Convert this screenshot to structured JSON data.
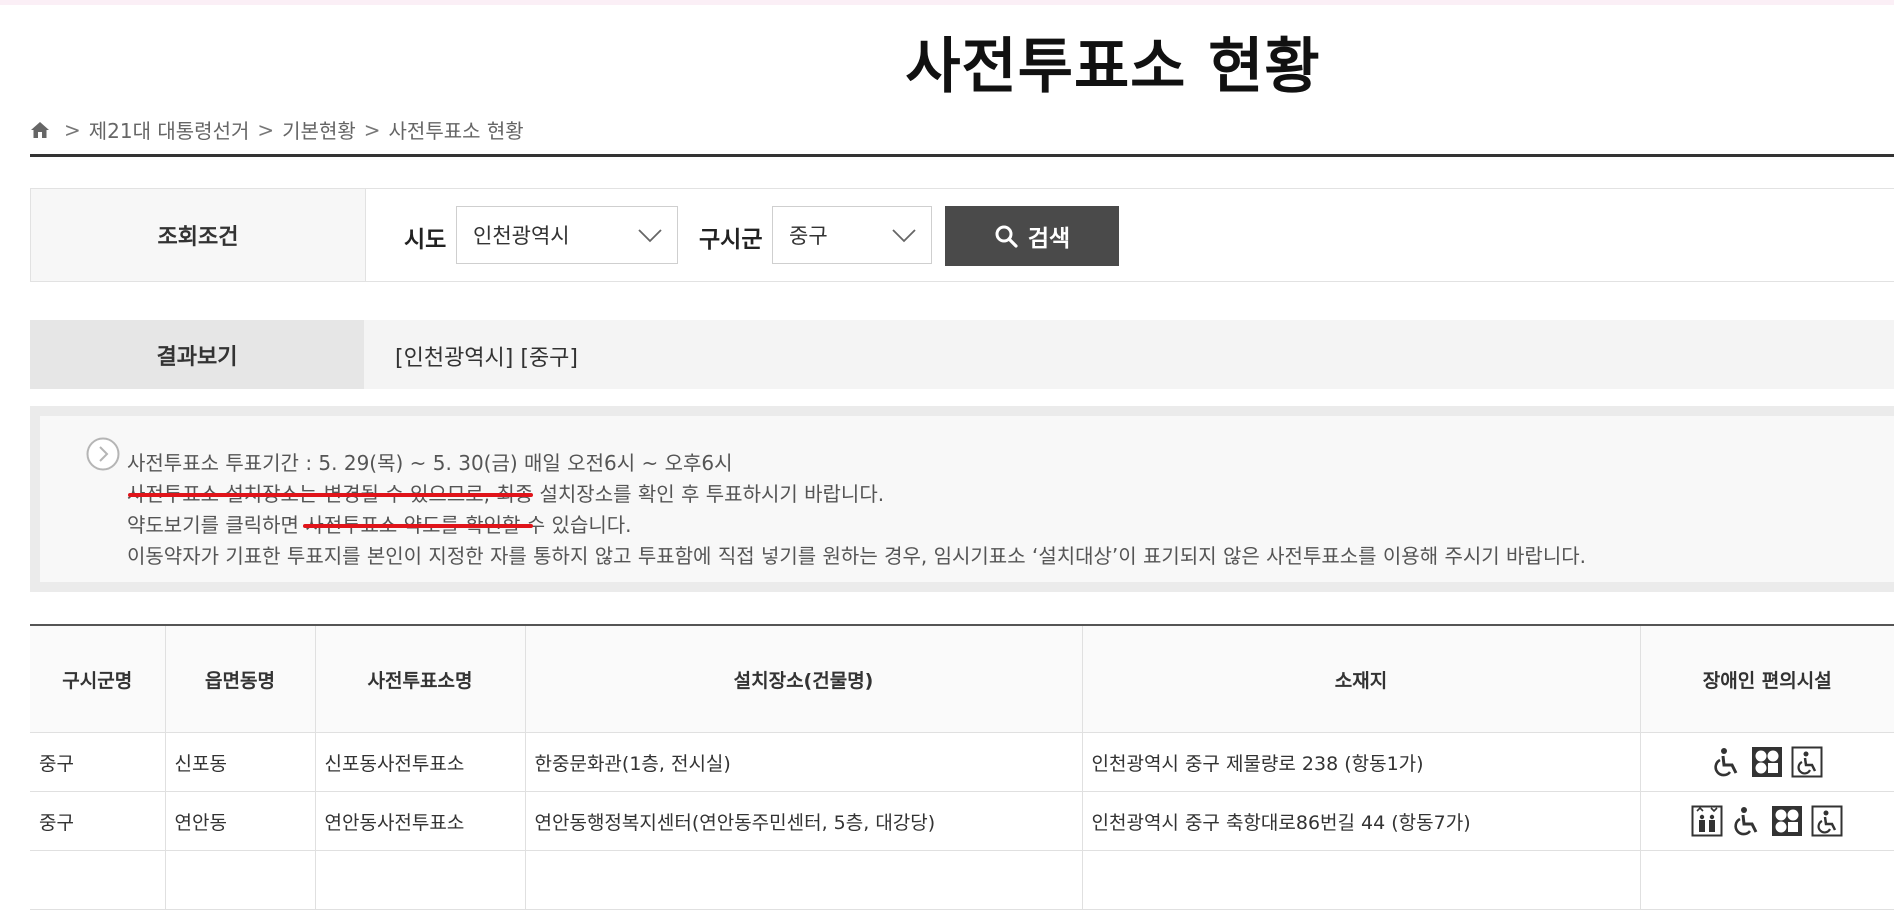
{
  "page_title": "사전투표소 현황",
  "breadcrumb": {
    "items": [
      "제21대 대통령선거",
      "기본현황",
      "사전투표소 현황"
    ],
    "separator": ">"
  },
  "search": {
    "label": "조회조건",
    "sido_label": "시도",
    "sido_value": "인천광역시",
    "sigungu_label": "구시군",
    "sigungu_value": "중구",
    "button_label": "검색"
  },
  "result": {
    "label": "결과보기",
    "value": "[인천광역시] [중구]"
  },
  "notice": {
    "lines": [
      "사전투표소 투표기간 : 5. 29(목) ~ 5. 30(금) 매일 오전6시 ~ 오후6시",
      "사전투표소 설치장소는 변경될 수 있으므로, 최종 설치장소를 확인 후 투표하시기 바랍니다.",
      "약도보기를 클릭하면 사전투표소 약도를 확인할 수 있습니다.",
      "이동약자가 기표한 투표지를 본인이 지정한 자를 통하지 않고 투표함에 직접 넣기를 원하는 경우, 임시기표소 ‘설치대상’이 표기되지 않은 사전투표소를 이용해 주시기 바랍니다."
    ],
    "underline_color": "#e0141a"
  },
  "table": {
    "headers": [
      "구시군명",
      "읍면동명",
      "사전투표소명",
      "설치장소(건물명)",
      "소재지",
      "장애인 편의시설"
    ],
    "rows": [
      {
        "cells": [
          "중구",
          "신포동",
          "신포동사전투표소",
          "한중문화관(1층, 전시실)",
          "인천광역시 중구 제물량로 238 (항동1가)"
        ],
        "facilities": [
          "wheelchair-icon",
          "braille-block-icon",
          "wheelchair-ramp-icon"
        ]
      },
      {
        "cells": [
          "중구",
          "연안동",
          "연안동사전투표소",
          "연안동행정복지센터(연안동주민센터, 5층, 대강당)",
          "인천광역시 중구 축항대로86번길 44 (항동7가)"
        ],
        "facilities": [
          "elevator-icon",
          "wheelchair-icon",
          "braille-block-icon",
          "wheelchair-ramp-icon"
        ]
      }
    ]
  },
  "colors": {
    "button_bg": "#4a4a4a",
    "label_bg": "#f7f7f7",
    "rule": "#333333"
  }
}
